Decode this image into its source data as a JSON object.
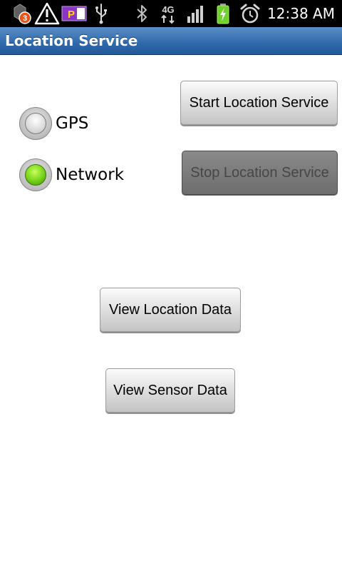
{
  "status_bar": {
    "notification_count": "3",
    "parking_label": "P",
    "network_type": "4G",
    "time": "12:38 AM",
    "icons": [
      "app-notification-icon",
      "warning-icon",
      "parking-icon",
      "usb-icon",
      "bluetooth-icon",
      "4g-data-icon",
      "signal-icon",
      "battery-charging-icon",
      "alarm-icon"
    ]
  },
  "title_bar": {
    "title": "Location Service"
  },
  "providers": {
    "gps_label": "GPS",
    "network_label": "Network",
    "selected": "Network"
  },
  "buttons": {
    "start_label": "Start Location Service",
    "stop_label": "Stop Location Service",
    "stop_enabled": false,
    "view_location_label": "View Location Data",
    "view_sensor_label": "View Sensor Data"
  },
  "colors": {
    "title_bar": "#2f69ab",
    "status_bar": "#000000",
    "radio_checked": "#74d11a",
    "battery": "#6fd12a",
    "badge": "#e8531a"
  }
}
